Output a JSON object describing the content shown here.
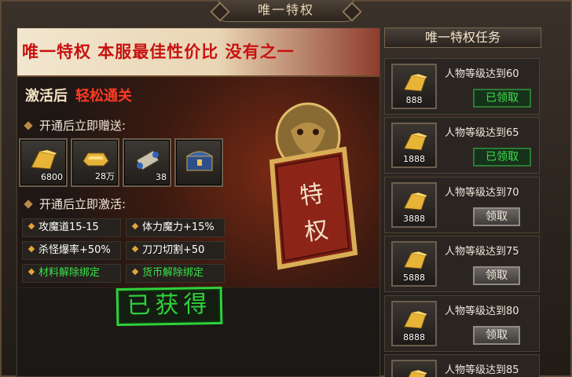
{
  "window": {
    "title": "唯一特权"
  },
  "privilege": {
    "banner": "唯一特权  本服最佳性价比 没有之一",
    "subtitle_a": "激活后",
    "subtitle_b": "轻松通关",
    "gift_heading": "开通后立即赠送:",
    "gifts": [
      {
        "icon": "gold-ingot-icon",
        "qty": "6800"
      },
      {
        "icon": "gold-bar-icon",
        "qty": "28万"
      },
      {
        "icon": "scroll-icon",
        "qty": "38"
      },
      {
        "icon": "treasure-chest-icon",
        "qty": ""
      }
    ],
    "activate_heading": "开通后立即激活:",
    "attributes": [
      {
        "label": "攻魔道15-15",
        "color": "#ffffff"
      },
      {
        "label": "体力魔力+15%",
        "color": "#ffffff"
      },
      {
        "label": "杀怪爆率+50%",
        "color": "#ffffff"
      },
      {
        "label": "刀刀切割+50",
        "color": "#ffffff"
      },
      {
        "label": "材料解除绑定",
        "color": "#38e34a"
      },
      {
        "label": "货币解除绑定",
        "color": "#38e34a"
      }
    ],
    "emblem_text": "特权",
    "status_stamp": "已获得"
  },
  "tasks": {
    "title": "唯一特权任务",
    "items": [
      {
        "label": "人物等级达到60",
        "reward_qty": "888",
        "button": "已领取",
        "state": "claimed"
      },
      {
        "label": "人物等级达到65",
        "reward_qty": "1888",
        "button": "已领取",
        "state": "claimed"
      },
      {
        "label": "人物等级达到70",
        "reward_qty": "3888",
        "button": "领取",
        "state": "claimable"
      },
      {
        "label": "人物等级达到75",
        "reward_qty": "5888",
        "button": "领取",
        "state": "claimable"
      },
      {
        "label": "人物等级达到80",
        "reward_qty": "8888",
        "button": "领取",
        "state": "claimable"
      },
      {
        "label": "人物等级达到85",
        "reward_qty": "",
        "button": "",
        "state": "partial"
      }
    ]
  },
  "colors": {
    "accent_red": "#c8120f",
    "claimed_green": "#38e34a",
    "gold": "#e3a33a"
  }
}
